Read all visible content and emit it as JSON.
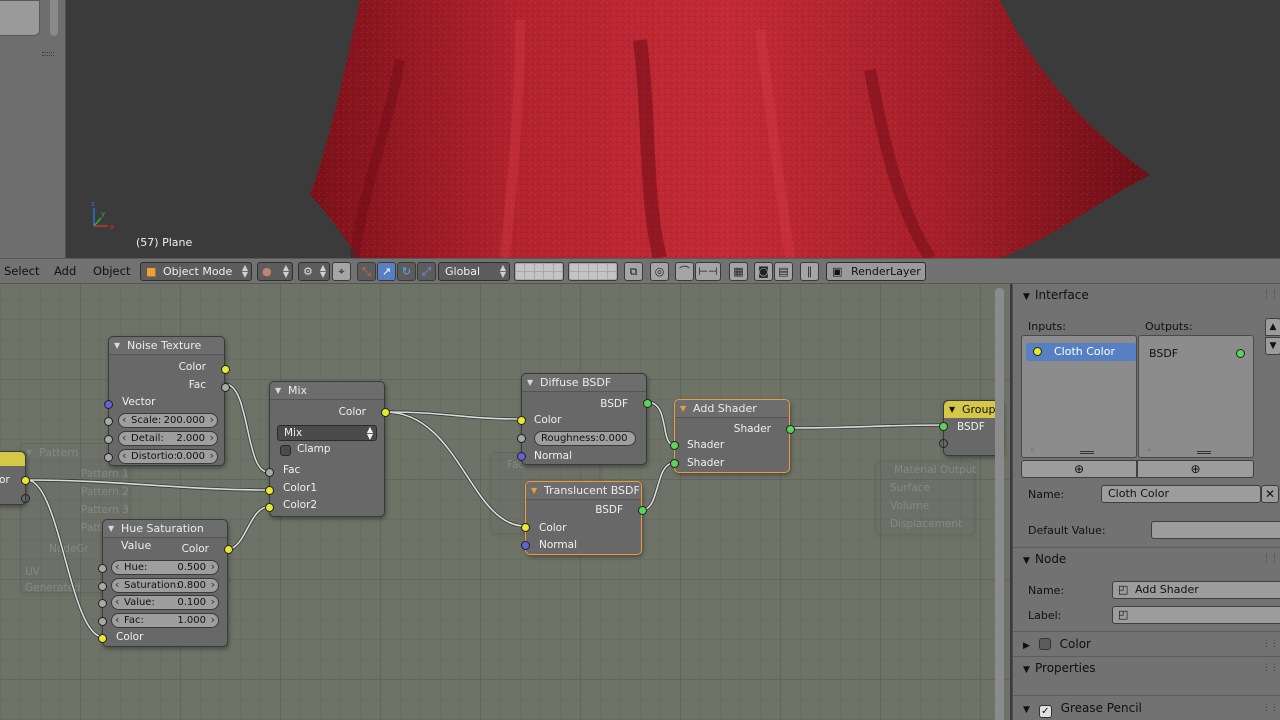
{
  "viewport": {
    "object_label": "(57) Plane",
    "colors": {
      "cloth": "#b3232e",
      "background": "#3b3b3b"
    }
  },
  "header": {
    "menus": [
      "Select",
      "Add",
      "Object"
    ],
    "mode": "Object Mode",
    "pivot": "Global",
    "render_layer": "RenderLayer"
  },
  "nodes": {
    "noise": {
      "title": "Noise Texture",
      "out_color": "Color",
      "out_fac": "Fac",
      "in_vector": "Vector",
      "fields": [
        {
          "k": "Scale:",
          "v": "200.000"
        },
        {
          "k": "Detail:",
          "v": "2.000"
        },
        {
          "k": "Distortio:",
          "v": "0.000"
        }
      ]
    },
    "mix": {
      "title": "Mix",
      "out_color": "Color",
      "blend": "Mix",
      "clamp": "Clamp",
      "in_fac": "Fac",
      "in_color1": "Color1",
      "in_color2": "Color2"
    },
    "hsv": {
      "title": "Hue Saturation Value",
      "out_color": "Color",
      "fields": [
        {
          "k": "Hue:",
          "v": "0.500"
        },
        {
          "k": "Saturation:",
          "v": "0.800"
        },
        {
          "k": "Value:",
          "v": "0.100"
        },
        {
          "k": "Fac:",
          "v": "1.000"
        }
      ],
      "in_color": "Color"
    },
    "diffuse": {
      "title": "Diffuse BSDF",
      "out_bsdf": "BSDF",
      "in_color": "Color",
      "roughness": "Roughness:0.000",
      "in_normal": "Normal"
    },
    "translucent": {
      "title": "Translucent BSDF",
      "out_bsdf": "BSDF",
      "in_color": "Color",
      "in_normal": "Normal"
    },
    "add_shader": {
      "title": "Add Shader",
      "out_shader": "Shader",
      "in_shader1": "Shader",
      "in_shader2": "Shader"
    },
    "group": {
      "title": "Group",
      "out_bsdf": "BSDF"
    },
    "group_input": {
      "label": "or"
    },
    "ghost_pattern": {
      "title": "Pattern",
      "rows": [
        "Pattern 1",
        "Pattern 2",
        "Pattern 3",
        "Patter"
      ],
      "node_group": "NodeGr",
      "uv": "UV",
      "generated": "Generated"
    },
    "ghost_output": {
      "title": "Material Output",
      "rows": [
        "Surface",
        "Volume",
        "Displacement"
      ]
    },
    "ghost_fac": "Fac"
  },
  "properties": {
    "interface": {
      "header": "Interface",
      "inputs_label": "Inputs:",
      "outputs_label": "Outputs:",
      "input_items": [
        "Cloth Color"
      ],
      "output_items": [
        "BSDF"
      ],
      "name_label": "Name:",
      "name_value": "Cloth Color",
      "default_label": "Default Value:"
    },
    "node": {
      "header": "Node",
      "name_label": "Name:",
      "name_value": "Add Shader",
      "label_label": "Label:",
      "label_value": ""
    },
    "color_header": "Color",
    "properties_header": "Properties",
    "grease_pencil_header": "Grease Pencil"
  }
}
